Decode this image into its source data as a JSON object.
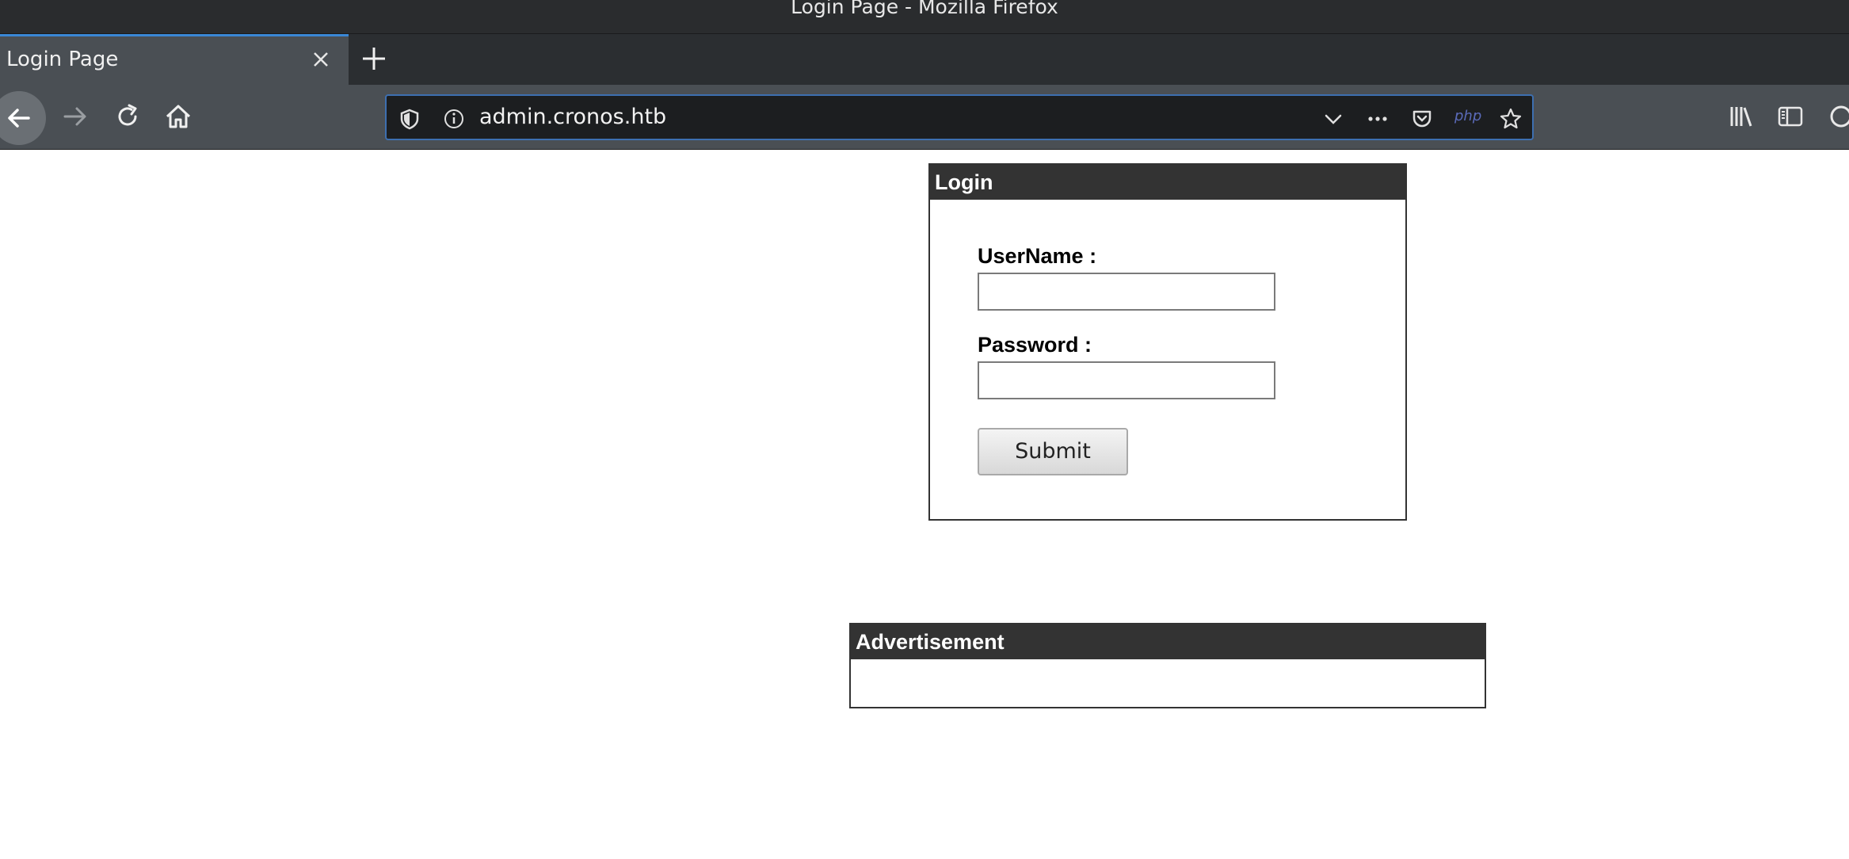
{
  "window": {
    "title": "Login Page - Mozilla Firefox"
  },
  "tabs": [
    {
      "label": "Login Page",
      "active": true
    }
  ],
  "toolbar": {
    "url": "admin.cronos.htb",
    "php_badge": "php",
    "icons": [
      "back-arrow-icon",
      "forward-arrow-icon",
      "reload-icon",
      "home-icon",
      "shield-icon",
      "info-icon",
      "chevron-down-icon",
      "more-dots-icon",
      "pocket-icon",
      "bookmark-star-icon",
      "library-icon",
      "sidebar-icon"
    ]
  },
  "login": {
    "header": "Login",
    "username_label": "UserName :",
    "username_value": "",
    "password_label": "Password :",
    "password_value": "",
    "submit_label": "Submit"
  },
  "advertisement": {
    "header": "Advertisement"
  },
  "colors": {
    "panel_header": "#333333",
    "url_border": "#3d6fb0",
    "tab_accent": "#3a88d6"
  }
}
